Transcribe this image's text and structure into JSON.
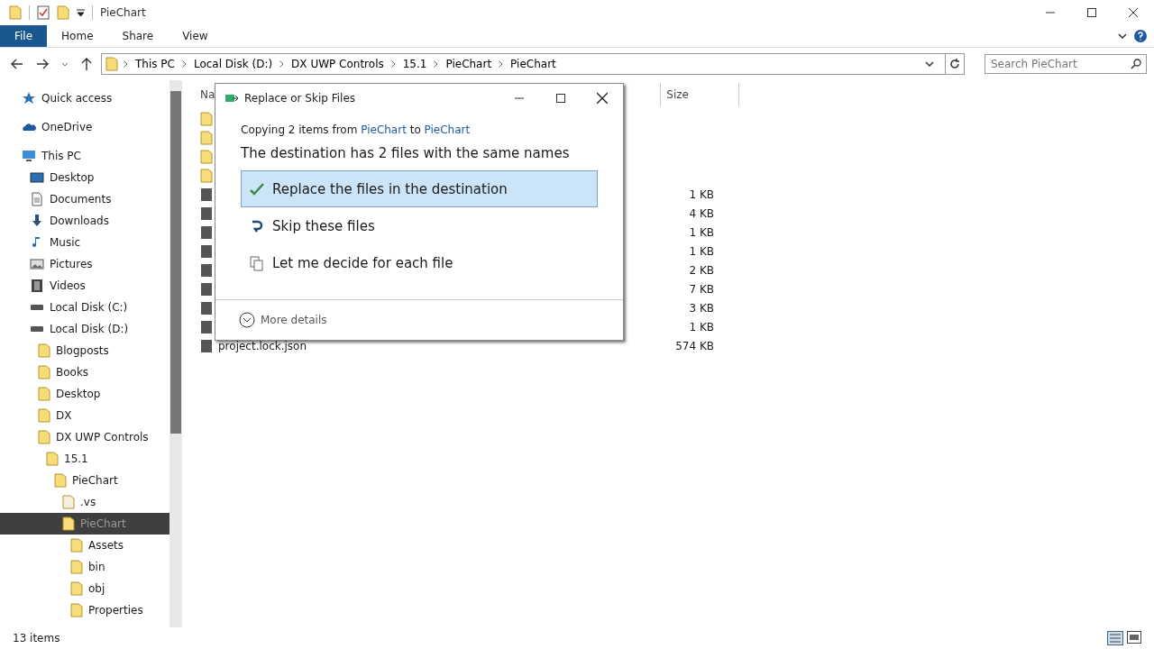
{
  "window": {
    "title": "PieChart"
  },
  "ribbon_tabs": [
    {
      "label": "File",
      "selected": true
    },
    {
      "label": "Home",
      "selected": false
    },
    {
      "label": "Share",
      "selected": false
    },
    {
      "label": "View",
      "selected": false
    }
  ],
  "address": {
    "path": [
      "This PC",
      "Local Disk (D:)",
      "DX UWP Controls",
      "15.1",
      "PieChart",
      "PieChart"
    ]
  },
  "search": {
    "placeholder": "Search PieChart"
  },
  "sidebar": {
    "items": [
      {
        "label": "Quick access",
        "kind": "star",
        "selected": false
      },
      {
        "label": "OneDrive",
        "kind": "cloud",
        "selected": false
      },
      {
        "label": "This PC",
        "kind": "pc",
        "selected": false,
        "children": [
          {
            "label": "Desktop",
            "kind": "desktop",
            "selected": false
          },
          {
            "label": "Documents",
            "kind": "docs",
            "selected": false
          },
          {
            "label": "Downloads",
            "kind": "download",
            "selected": false
          },
          {
            "label": "Music",
            "kind": "music",
            "selected": false
          },
          {
            "label": "Pictures",
            "kind": "pictures",
            "selected": false
          },
          {
            "label": "Videos",
            "kind": "videos",
            "selected": false
          },
          {
            "label": "Local Disk (C:)",
            "kind": "drive",
            "selected": false
          },
          {
            "label": "Local Disk (D:)",
            "kind": "drive",
            "selected": false,
            "children": [
              {
                "label": "Blogposts",
                "kind": "folder",
                "selected": false
              },
              {
                "label": "Books",
                "kind": "folder",
                "selected": false
              },
              {
                "label": "Desktop",
                "kind": "folder",
                "selected": false
              },
              {
                "label": "DX",
                "kind": "folder",
                "selected": false
              },
              {
                "label": "DX UWP Controls",
                "kind": "folder",
                "selected": false,
                "children": [
                  {
                    "label": "15.1",
                    "kind": "folder",
                    "selected": false,
                    "children": [
                      {
                        "label": "PieChart",
                        "kind": "folder",
                        "selected": false,
                        "children": [
                          {
                            "label": ".vs",
                            "kind": "hidden",
                            "selected": false
                          },
                          {
                            "label": "PieChart",
                            "kind": "folder",
                            "selected": true,
                            "children": [
                              {
                                "label": "Assets",
                                "kind": "folder",
                                "selected": false
                              },
                              {
                                "label": "bin",
                                "kind": "folder",
                                "selected": false
                              },
                              {
                                "label": "obj",
                                "kind": "folder",
                                "selected": false
                              },
                              {
                                "label": "Properties",
                                "kind": "folder",
                                "selected": false
                              }
                            ]
                          }
                        ]
                      }
                    ]
                  }
                ]
              }
            ]
          }
        ]
      }
    ]
  },
  "file_list": {
    "columns": [
      "Na",
      "Size"
    ],
    "rows": [
      {
        "kind": "folder"
      },
      {
        "kind": "folder"
      },
      {
        "kind": "folder"
      },
      {
        "kind": "folder"
      },
      {
        "kind": "file",
        "size": "1 KB"
      },
      {
        "kind": "file",
        "size": "4 KB"
      },
      {
        "kind": "file",
        "size": "1 KB"
      },
      {
        "kind": "file",
        "size": "1 KB"
      },
      {
        "kind": "file",
        "size": "2 KB"
      },
      {
        "kind": "file",
        "size": "7 KB"
      },
      {
        "kind": "file",
        "size": "3 KB"
      },
      {
        "kind": "file",
        "size": "1 KB"
      },
      {
        "kind": "file",
        "name": "project.lock.json",
        "size": "574 KB"
      }
    ]
  },
  "dialog": {
    "title": "Replace or Skip Files",
    "copy_line": [
      {
        "kind": "text",
        "text": "Copying 2 items from "
      },
      {
        "kind": "link",
        "text": "PieChart"
      },
      {
        "kind": "text",
        "text": " to "
      },
      {
        "kind": "link",
        "text": "PieChart"
      }
    ],
    "heading": "The destination has 2 files with the same names",
    "options": [
      {
        "kind": "replace",
        "label": "Replace the files in the destination",
        "selected": true
      },
      {
        "kind": "skip",
        "label": "Skip these files",
        "selected": false
      },
      {
        "kind": "decide",
        "label": "Let me decide for each file",
        "selected": false
      }
    ],
    "details": "More details"
  },
  "status_bar": {
    "count": "13 items"
  }
}
